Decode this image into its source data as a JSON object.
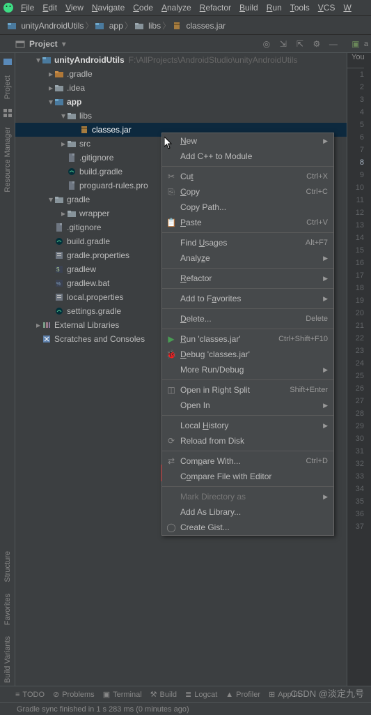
{
  "menubar": [
    "File",
    "Edit",
    "View",
    "Navigate",
    "Code",
    "Analyze",
    "Refactor",
    "Build",
    "Run",
    "Tools",
    "VCS",
    "W"
  ],
  "breadcrumbs": [
    {
      "label": "unityAndroidUtils",
      "icon": "module"
    },
    {
      "label": "app",
      "icon": "module"
    },
    {
      "label": "libs",
      "icon": "folder"
    },
    {
      "label": "classes.jar",
      "icon": "jar"
    }
  ],
  "tool_pane": {
    "title": "Project",
    "dd": "▾"
  },
  "leftbar": {
    "project": "Project",
    "resmgr": "Resource Manager",
    "structure": "Structure",
    "favorites": "Favorites",
    "buildvariants": "Build Variants"
  },
  "tree": [
    {
      "depth": 0,
      "arrow": "▾",
      "icon": "module",
      "label": "unityAndroidUtils",
      "bold": true,
      "hint": "F:\\AllProjects\\AndroidStudio\\unityAndroidUtils"
    },
    {
      "depth": 1,
      "arrow": "▸",
      "icon": "folder-ex",
      "label": ".gradle"
    },
    {
      "depth": 1,
      "arrow": "▸",
      "icon": "folder",
      "label": ".idea"
    },
    {
      "depth": 1,
      "arrow": "▾",
      "icon": "module",
      "label": "app",
      "bold": true
    },
    {
      "depth": 2,
      "arrow": "▾",
      "icon": "folder",
      "label": "libs"
    },
    {
      "depth": 3,
      "arrow": "",
      "icon": "jar",
      "label": "classes.jar",
      "selected": true
    },
    {
      "depth": 2,
      "arrow": "▸",
      "icon": "folder",
      "label": "src"
    },
    {
      "depth": 2,
      "arrow": "",
      "icon": "file",
      "label": ".gitignore"
    },
    {
      "depth": 2,
      "arrow": "",
      "icon": "gradle",
      "label": "build.gradle"
    },
    {
      "depth": 2,
      "arrow": "",
      "icon": "file",
      "label": "proguard-rules.pro"
    },
    {
      "depth": 1,
      "arrow": "▾",
      "icon": "folder",
      "label": "gradle"
    },
    {
      "depth": 2,
      "arrow": "▸",
      "icon": "folder",
      "label": "wrapper"
    },
    {
      "depth": 1,
      "arrow": "",
      "icon": "file",
      "label": ".gitignore"
    },
    {
      "depth": 1,
      "arrow": "",
      "icon": "gradle",
      "label": "build.gradle"
    },
    {
      "depth": 1,
      "arrow": "",
      "icon": "props",
      "label": "gradle.properties"
    },
    {
      "depth": 1,
      "arrow": "",
      "icon": "sh",
      "label": "gradlew"
    },
    {
      "depth": 1,
      "arrow": "",
      "icon": "bat",
      "label": "gradlew.bat"
    },
    {
      "depth": 1,
      "arrow": "",
      "icon": "props",
      "label": "local.properties"
    },
    {
      "depth": 1,
      "arrow": "",
      "icon": "gradle",
      "label": "settings.gradle"
    },
    {
      "depth": 0,
      "arrow": "▸",
      "icon": "lib",
      "label": "External Libraries"
    },
    {
      "depth": 0,
      "arrow": "",
      "icon": "scratch",
      "label": "Scratches and Consoles"
    }
  ],
  "gutter": {
    "tab": "You",
    "lines": 37,
    "active": 8
  },
  "context_menu": [
    {
      "label": "New",
      "sub": true
    },
    {
      "label": "Add C++ to Module"
    },
    {
      "sep": true
    },
    {
      "icon": "cut",
      "label": "Cut",
      "shortcut": "Ctrl+X"
    },
    {
      "icon": "copy",
      "label": "Copy",
      "shortcut": "Ctrl+C"
    },
    {
      "label": "Copy Path..."
    },
    {
      "icon": "paste",
      "label": "Paste",
      "shortcut": "Ctrl+V"
    },
    {
      "sep": true
    },
    {
      "label": "Find Usages",
      "shortcut": "Alt+F7"
    },
    {
      "label": "Analyze",
      "sub": true
    },
    {
      "sep": true
    },
    {
      "label": "Refactor",
      "sub": true
    },
    {
      "sep": true
    },
    {
      "label": "Add to Favorites",
      "sub": true
    },
    {
      "sep": true
    },
    {
      "label": "Delete...",
      "shortcut": "Delete"
    },
    {
      "sep": true
    },
    {
      "icon": "run",
      "label": "Run 'classes.jar'",
      "shortcut": "Ctrl+Shift+F10"
    },
    {
      "icon": "debug",
      "label": "Debug 'classes.jar'"
    },
    {
      "label": "More Run/Debug",
      "sub": true
    },
    {
      "sep": true
    },
    {
      "icon": "split",
      "label": "Open in Right Split",
      "shortcut": "Shift+Enter"
    },
    {
      "label": "Open In",
      "sub": true
    },
    {
      "sep": true
    },
    {
      "label": "Local History",
      "sub": true
    },
    {
      "icon": "reload",
      "label": "Reload from Disk"
    },
    {
      "sep": true
    },
    {
      "icon": "diff",
      "label": "Compare With...",
      "shortcut": "Ctrl+D"
    },
    {
      "label": "Compare File with Editor"
    },
    {
      "sep": true
    },
    {
      "label": "Mark Directory as",
      "sub": true,
      "disabled": true
    },
    {
      "label": "Add As Library...",
      "highlight": true
    },
    {
      "icon": "github",
      "label": "Create Gist..."
    }
  ],
  "bottombar": {
    "todo": "TODO",
    "problems": "Problems",
    "terminal": "Terminal",
    "build": "Build",
    "logcat": "Logcat",
    "profiler": "Profiler",
    "appinsp": "App In"
  },
  "statusbar": "Gradle sync finished in 1 s 283 ms (0 minutes ago)",
  "watermark": "CSDN @淡定九号"
}
